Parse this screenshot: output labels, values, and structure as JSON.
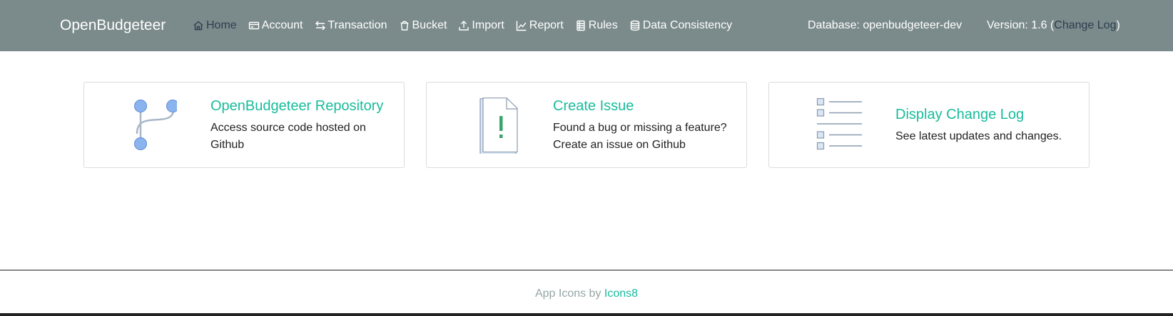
{
  "app": {
    "brand": "OpenBudgeteer"
  },
  "nav": {
    "items": [
      {
        "label": "Home",
        "icon": "home-icon",
        "active": true
      },
      {
        "label": "Account",
        "icon": "credit-card-icon"
      },
      {
        "label": "Transaction",
        "icon": "arrows-exchange-icon"
      },
      {
        "label": "Bucket",
        "icon": "bucket-icon"
      },
      {
        "label": "Import",
        "icon": "upload-icon"
      },
      {
        "label": "Report",
        "icon": "line-chart-icon"
      },
      {
        "label": "Rules",
        "icon": "list-icon"
      },
      {
        "label": "Data Consistency",
        "icon": "database-icon"
      }
    ],
    "database_label": "Database: openbudgeteer-dev",
    "version_prefix": "Version: 1.6 (",
    "version_link": "Change Log",
    "version_suffix": ")"
  },
  "cards": [
    {
      "title": "OpenBudgeteer Repository",
      "desc_line1": "Access source code hosted on",
      "desc_line2": "Github",
      "icon": "git-branch-icon"
    },
    {
      "title": "Create Issue",
      "desc_line1": "Found a bug or missing a feature?",
      "desc_line2": "Create an issue on Github",
      "icon": "document-exclamation-icon"
    },
    {
      "title": "Display Change Log",
      "desc_line1": "See latest updates and changes.",
      "icon": "checklist-icon"
    }
  ],
  "footer": {
    "prefix": "App Icons by ",
    "link": "Icons8"
  },
  "colors": {
    "navbar": "#7b8a8b",
    "accent": "#18bc9c",
    "active_nav": "#2c3e50",
    "icon_blue": "#8ab4f0"
  }
}
